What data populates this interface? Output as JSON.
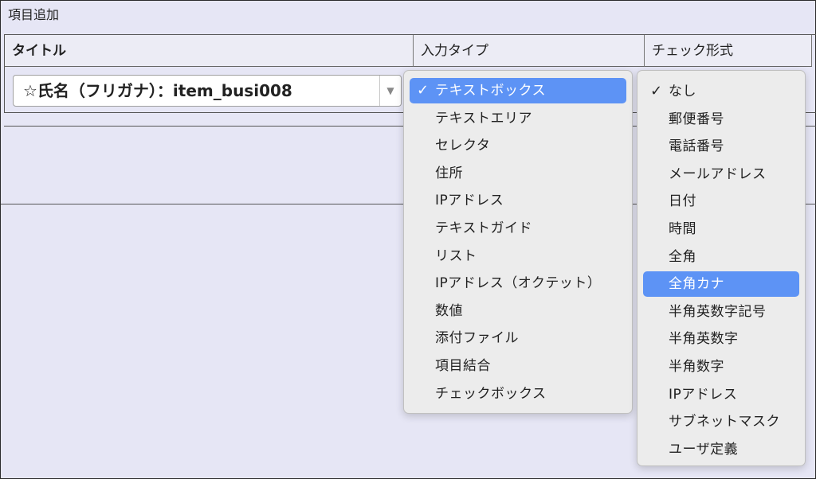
{
  "panel": {
    "title": "項目追加"
  },
  "table": {
    "headers": {
      "title": "タイトル",
      "input_type": "入力タイプ",
      "check_format": "チェック形式"
    },
    "row": {
      "title_select_value": "☆氏名（フリガナ）：item_busi008",
      "select_arrow": "▼"
    }
  },
  "input_type_menu": {
    "check_glyph": "✓",
    "items": [
      "テキストボックス",
      "テキストエリア",
      "セレクタ",
      "住所",
      "IPアドレス",
      "テキストガイド",
      "リスト",
      "IPアドレス（オクテット）",
      "数値",
      "添付ファイル",
      "項目結合",
      "チェックボックス"
    ],
    "checked_index": 0,
    "highlighted_index": 0
  },
  "check_format_menu": {
    "check_glyph": "✓",
    "items": [
      "なし",
      "郵便番号",
      "電話番号",
      "メールアドレス",
      "日付",
      "時間",
      "全角",
      "全角カナ",
      "半角英数字記号",
      "半角英数字",
      "半角数字",
      "IPアドレス",
      "サブネットマスク",
      "ユーザ定義"
    ],
    "checked_index": 0,
    "highlighted_index": 7
  },
  "colors": {
    "background": "#e6e6f5",
    "highlight": "#5d93f5",
    "menu_bg": "#ececec"
  }
}
